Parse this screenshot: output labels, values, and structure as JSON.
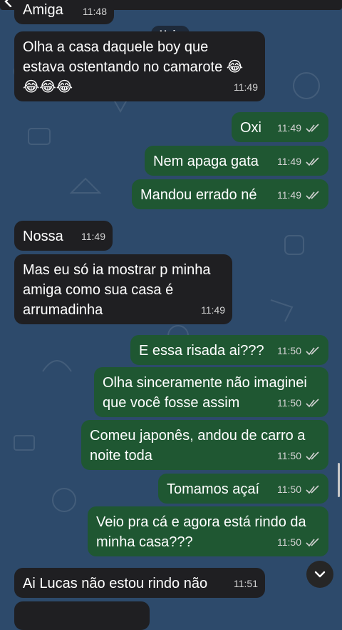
{
  "header": {
    "date_label": "Hoje"
  },
  "messages": [
    {
      "dir": "in",
      "text": "Amiga",
      "time": "11:48"
    },
    {
      "dir": "in",
      "text": "Olha a casa daquele boy que\nestava ostentando no camarote 😂\n😂😂😂",
      "time": "11:49"
    },
    {
      "dir": "out",
      "text": "Oxi",
      "time": "11:49"
    },
    {
      "dir": "out",
      "text": "Nem apaga gata",
      "time": "11:49"
    },
    {
      "dir": "out",
      "text": "Mandou errado né",
      "time": "11:49"
    },
    {
      "dir": "in",
      "text": "Nossa",
      "time": "11:49"
    },
    {
      "dir": "in",
      "text": "Mas eu só ia mostrar p minha\namiga como sua casa é\narrumadinha",
      "time": "11:49"
    },
    {
      "dir": "out",
      "text": "E essa risada ai???",
      "time": "11:50"
    },
    {
      "dir": "out",
      "text": "Olha sinceramente não imaginei\nque você fosse assim",
      "time": "11:50"
    },
    {
      "dir": "out",
      "text": "Comeu japonês, andou de carro a\nnoite toda",
      "time": "11:50"
    },
    {
      "dir": "out",
      "text": "Tomamos açaí",
      "time": "11:50"
    },
    {
      "dir": "out",
      "text": "Veio pra cá e agora está rindo da\nminha casa???",
      "time": "11:50"
    },
    {
      "dir": "in",
      "text": "Ai Lucas não estou rindo não",
      "time": "11:51"
    }
  ]
}
